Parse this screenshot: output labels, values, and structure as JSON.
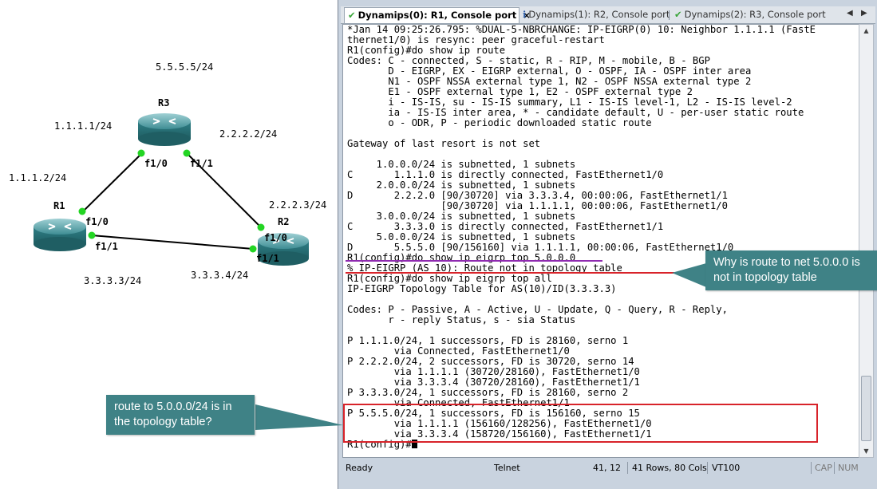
{
  "topology": {
    "labels": {
      "net_r3_loopback": "5.5.5.5/24",
      "r3_f10_ip": "1.1.1.1/24",
      "r3_f11_ip": "2.2.2.2/24",
      "r1_f10_ip": "1.1.1.2/24",
      "r2_f10_ip": "2.2.2.3/24",
      "r1_f11_ip": "3.3.3.3/24",
      "r2_f11_ip": "3.3.3.4/24"
    },
    "routers": {
      "r1": "R1",
      "r2": "R2",
      "r3": "R3"
    },
    "interfaces": {
      "r3_f10": "f1/0",
      "r3_f11": "f1/1",
      "r1_f10": "f1/0",
      "r1_f11": "f1/1",
      "r2_f10": "f1/0",
      "r2_f11": "f1/1"
    },
    "colors": {
      "router_body": "#2f7f86",
      "link": "#000000",
      "port": "#23d523"
    }
  },
  "tabs": [
    {
      "label": "Dynamips(0): R1, Console port",
      "active": true,
      "icon": "check-icon",
      "close": "×"
    },
    {
      "label": "Dynamips(1): R2, Console port",
      "active": false,
      "icon": "info-icon"
    },
    {
      "label": "Dynamips(2): R3, Console port",
      "active": false,
      "icon": "check-icon"
    }
  ],
  "tab_nav": {
    "prev": "◀",
    "next": "▶"
  },
  "console": {
    "lines": [
      "*Jan 14 09:25:26.795: %DUAL-5-NBRCHANGE: IP-EIGRP(0) 10: Neighbor 1.1.1.1 (FastE",
      "thernet1/0) is resync: peer graceful-restart",
      "R1(config)#do show ip route",
      "Codes: C - connected, S - static, R - RIP, M - mobile, B - BGP",
      "       D - EIGRP, EX - EIGRP external, O - OSPF, IA - OSPF inter area",
      "       N1 - OSPF NSSA external type 1, N2 - OSPF NSSA external type 2",
      "       E1 - OSPF external type 1, E2 - OSPF external type 2",
      "       i - IS-IS, su - IS-IS summary, L1 - IS-IS level-1, L2 - IS-IS level-2",
      "       ia - IS-IS inter area, * - candidate default, U - per-user static route",
      "       o - ODR, P - periodic downloaded static route",
      "",
      "Gateway of last resort is not set",
      "",
      "     1.0.0.0/24 is subnetted, 1 subnets",
      "C       1.1.1.0 is directly connected, FastEthernet1/0",
      "     2.0.0.0/24 is subnetted, 1 subnets",
      "D       2.2.2.0 [90/30720] via 3.3.3.4, 00:00:06, FastEthernet1/1",
      "                [90/30720] via 1.1.1.1, 00:00:06, FastEthernet1/0",
      "     3.0.0.0/24 is subnetted, 1 subnets",
      "C       3.3.3.0 is directly connected, FastEthernet1/1",
      "     5.0.0.0/24 is subnetted, 1 subnets",
      "D       5.5.5.0 [90/156160] via 1.1.1.1, 00:00:06, FastEthernet1/0",
      "R1(config)#do show ip eigrp top 5.0.0.0",
      "% IP-EIGRP (AS 10): Route not in topology table",
      "R1(config)#do show ip eigrp top all",
      "IP-EIGRP Topology Table for AS(10)/ID(3.3.3.3)",
      "",
      "Codes: P - Passive, A - Active, U - Update, Q - Query, R - Reply,",
      "       r - reply Status, s - sia Status",
      "",
      "P 1.1.1.0/24, 1 successors, FD is 28160, serno 1",
      "        via Connected, FastEthernet1/0",
      "P 2.2.2.0/24, 2 successors, FD is 30720, serno 14",
      "        via 1.1.1.1 (30720/28160), FastEthernet1/0",
      "        via 3.3.3.4 (30720/28160), FastEthernet1/1",
      "P 3.3.3.0/24, 1 successors, FD is 28160, serno 2",
      "        via Connected, FastEthernet1/1",
      "P 5.5.5.0/24, 1 successors, FD is 156160, serno 15",
      "        via 1.1.1.1 (156160/128256), FastEthernet1/0",
      "        via 3.3.3.4 (158720/156160), FastEthernet1/1",
      "R1(config)#"
    ]
  },
  "statusbar": {
    "state": "Ready",
    "protocol": "Telnet",
    "cursor_pos": "41, 12",
    "dimensions": "41 Rows, 80 Cols",
    "terminal_type": "VT100",
    "caps": "CAP",
    "num": "NUM"
  },
  "annotations": {
    "callout_right": "Why is route to net 5.0.0.0 is not in topology table",
    "callout_left": "route to 5.0.0.0/24 is in the topology table?",
    "color_callout": "#3f8286",
    "color_highlight": "#d8232a",
    "color_underline": "#8f2bb0"
  }
}
